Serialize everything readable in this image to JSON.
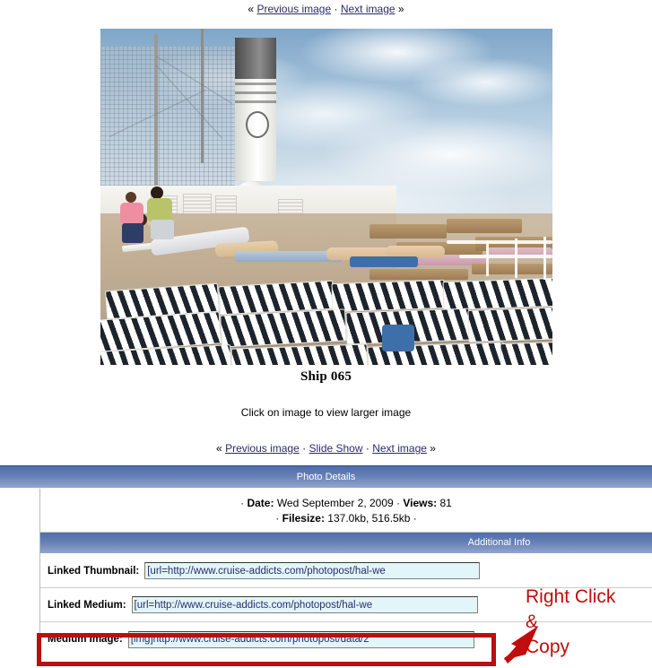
{
  "top_nav": {
    "prev": "Previous image",
    "next": "Next image",
    "left_guillemet": "«",
    "right_guillemet": "»",
    "separator": "·"
  },
  "photo": {
    "title": "Ship 065",
    "hint": "Click on image to view larger image",
    "alt": "Cruise ship deck with rows of striped lounge chairs, funnel, radar domes, ocean and sky"
  },
  "bottom_nav": {
    "prev": "Previous image",
    "slideshow": "Slide Show",
    "next": "Next image",
    "left_guillemet": "«",
    "right_guillemet": "»",
    "separator": "·"
  },
  "details": {
    "header": "Photo Details",
    "meta_line1_prefix": "· ",
    "date_label": "Date:",
    "date_value": " Wed September 2, 2009 ",
    "views_sep": "· ",
    "views_label": "Views:",
    "views_value": " 81",
    "meta_line2_prefix": "· ",
    "filesize_label": "Filesize:",
    "filesize_value": " 137.0kb, 516.5kb ·",
    "additional_info": "Additional Info",
    "rows": [
      {
        "label": "Linked Thumbnail:",
        "value": "[url=http://www.cruise-addicts.com/photopost/hal-we"
      },
      {
        "label": "Linked Medium:",
        "value": "[url=http://www.cruise-addicts.com/photopost/hal-we"
      },
      {
        "label": "Medium Image:",
        "value": "[img]http://www.cruise-addicts.com/photopost/data/2"
      }
    ]
  },
  "annotation": {
    "text": "Right Click\n&\nCopy",
    "color": "#c00d0d"
  },
  "colors": {
    "bar_dark": "#4f6da8",
    "bar_light": "#93a6cc",
    "link": "#2b2b6b",
    "selection_bg": "#e2f6f9",
    "annotation_red": "#c00d0d"
  }
}
